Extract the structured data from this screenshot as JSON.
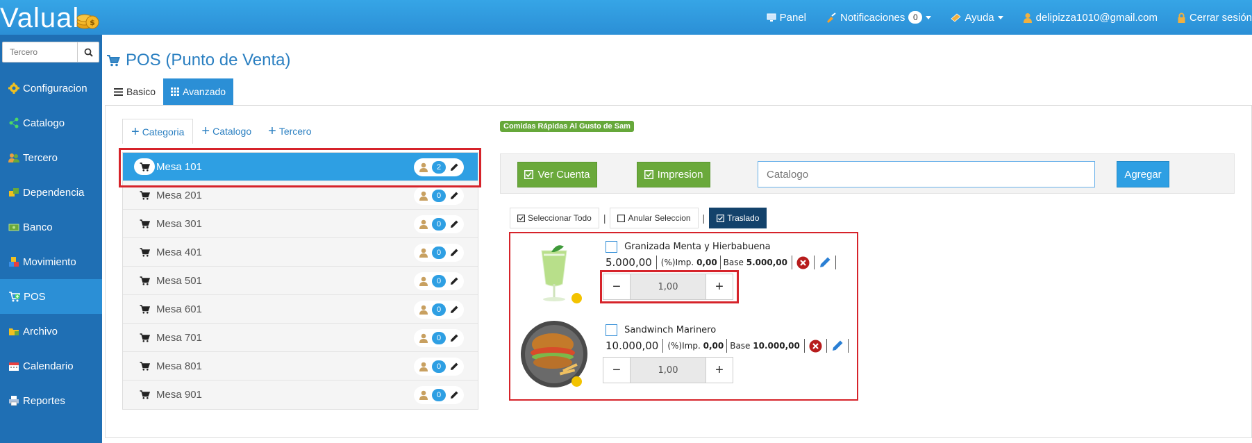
{
  "brand": {
    "logo_text": "Valual"
  },
  "topnav": {
    "panel": "Panel",
    "notificaciones": "Notificaciones",
    "notif_count": "0",
    "ayuda": "Ayuda",
    "user_email": "delipizza1010@gmail.com",
    "logout": "Cerrar sesión"
  },
  "sidebar": {
    "search_placeholder": "Tercero",
    "items": [
      {
        "label": "Configuracion",
        "icon": "gear-icon"
      },
      {
        "label": "Catalogo",
        "icon": "share-icon"
      },
      {
        "label": "Tercero",
        "icon": "users-icon"
      },
      {
        "label": "Dependencia",
        "icon": "building-icon"
      },
      {
        "label": "Banco",
        "icon": "money-icon"
      },
      {
        "label": "Movimiento",
        "icon": "boxes-icon"
      },
      {
        "label": "POS",
        "icon": "cart-add-icon",
        "active": true
      },
      {
        "label": "Archivo",
        "icon": "folder-icon"
      },
      {
        "label": "Calendario",
        "icon": "calendar-icon"
      },
      {
        "label": "Reportes",
        "icon": "printer-icon"
      }
    ]
  },
  "page": {
    "title": "POS (Punto de Venta)",
    "tabs": {
      "basico": "Basico",
      "avanzado": "Avanzado"
    }
  },
  "actions": {
    "categoria": "Categoria",
    "catalogo": "Catalogo",
    "tercero": "Tercero"
  },
  "mesas": [
    {
      "label": "Mesa 101",
      "count": "2",
      "active": true
    },
    {
      "label": "Mesa 201",
      "count": "0"
    },
    {
      "label": "Mesa 301",
      "count": "0"
    },
    {
      "label": "Mesa 401",
      "count": "0"
    },
    {
      "label": "Mesa 501",
      "count": "0"
    },
    {
      "label": "Mesa 601",
      "count": "0"
    },
    {
      "label": "Mesa 701",
      "count": "0"
    },
    {
      "label": "Mesa 801",
      "count": "0"
    },
    {
      "label": "Mesa 901",
      "count": "0"
    }
  ],
  "company_label": "Comidas Rápidas Al Gusto de Sam",
  "toolbar": {
    "ver_cuenta": "Ver Cuenta",
    "impresion": "Impresion",
    "catalog_placeholder": "Catalogo",
    "agregar": "Agregar"
  },
  "selection": {
    "seleccionar_todo": "Seleccionar Todo",
    "anular_seleccion": "Anular Seleccion",
    "traslado": "Traslado",
    "separator": "|"
  },
  "products": [
    {
      "name": "Granizada Menta y Hierbabuena",
      "price": "5.000,00",
      "imp_label": "(%)Imp.",
      "imp_value": "0,00",
      "base_label": "Base",
      "base_value": "5.000,00",
      "qty": "1,00",
      "status_color": "#f3c300"
    },
    {
      "name": "Sandwinch Marinero",
      "price": "10.000,00",
      "imp_label": "(%)Imp.",
      "imp_value": "0,00",
      "base_label": "Base",
      "base_value": "10.000,00",
      "qty": "1,00",
      "status_color": "#f3c300"
    }
  ],
  "colors": {
    "primary": "#2e9fe3",
    "sidebar": "#1f6fb4",
    "green": "#6aa93b",
    "highlight": "#d6232a",
    "dark_button": "#13426b"
  }
}
